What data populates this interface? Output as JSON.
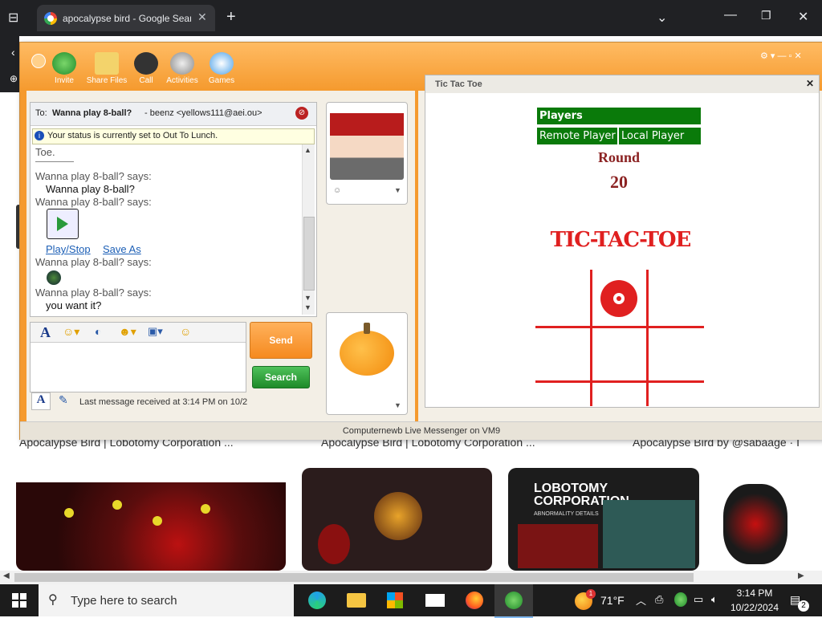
{
  "browser": {
    "tab_title": "apocalypse bird - Google Search",
    "new_tab": "+"
  },
  "page": {
    "captions": [
      "Apocalypse Bird | Lobotomy Corporation ...",
      "Apocalypse Bird | Lobotomy Corporation ...",
      "Apocalypse Bird by @sabaage · I"
    ],
    "thumb3_text": "LOBOTOMY CORPORATION",
    "thumb3_sub": "ABNORMALITY DETAILS"
  },
  "messenger": {
    "toolbar": [
      "Invite",
      "Share Files",
      "Call",
      "Activities",
      "Games"
    ],
    "to_label": "To:",
    "to_name": "Wanna play 8-ball?",
    "to_rest": "- beenz <yellows111@aei.ou>",
    "status_text": "Your status is currently set to Out To Lunch.",
    "log": {
      "toe": "Toe.",
      "says1": "Wanna play 8-ball? says:",
      "msg1": "Wanna play 8-ball?",
      "says2": "Wanna play 8-ball? says:",
      "play_stop": "Play/Stop",
      "save_as": "Save As",
      "says3": "Wanna play 8-ball? says:",
      "says4": "Wanna play 8-ball? says:",
      "msg4": "you want it?"
    },
    "send_label": "Send",
    "search_label": "Search",
    "last_message": "Last message received at 3:14 PM on 10/2",
    "footer": "Computernewb Live Messenger on VM9"
  },
  "tictactoe": {
    "title": "Tic Tac Toe",
    "players_label": "Players",
    "remote_label": "Remote Player",
    "local_label": "Local Player",
    "round_label": "Round",
    "round_value": "20",
    "logo": "TIC-TAC-TOE"
  },
  "taskbar": {
    "search_placeholder": "Type here to search",
    "weather": "71°F",
    "weather_badge": "1",
    "time": "3:14 PM",
    "date": "10/22/2024",
    "notifications": "2"
  },
  "colors": {
    "orange": "#f59a2e",
    "green": "#0a7a0a",
    "red": "#e02020"
  }
}
